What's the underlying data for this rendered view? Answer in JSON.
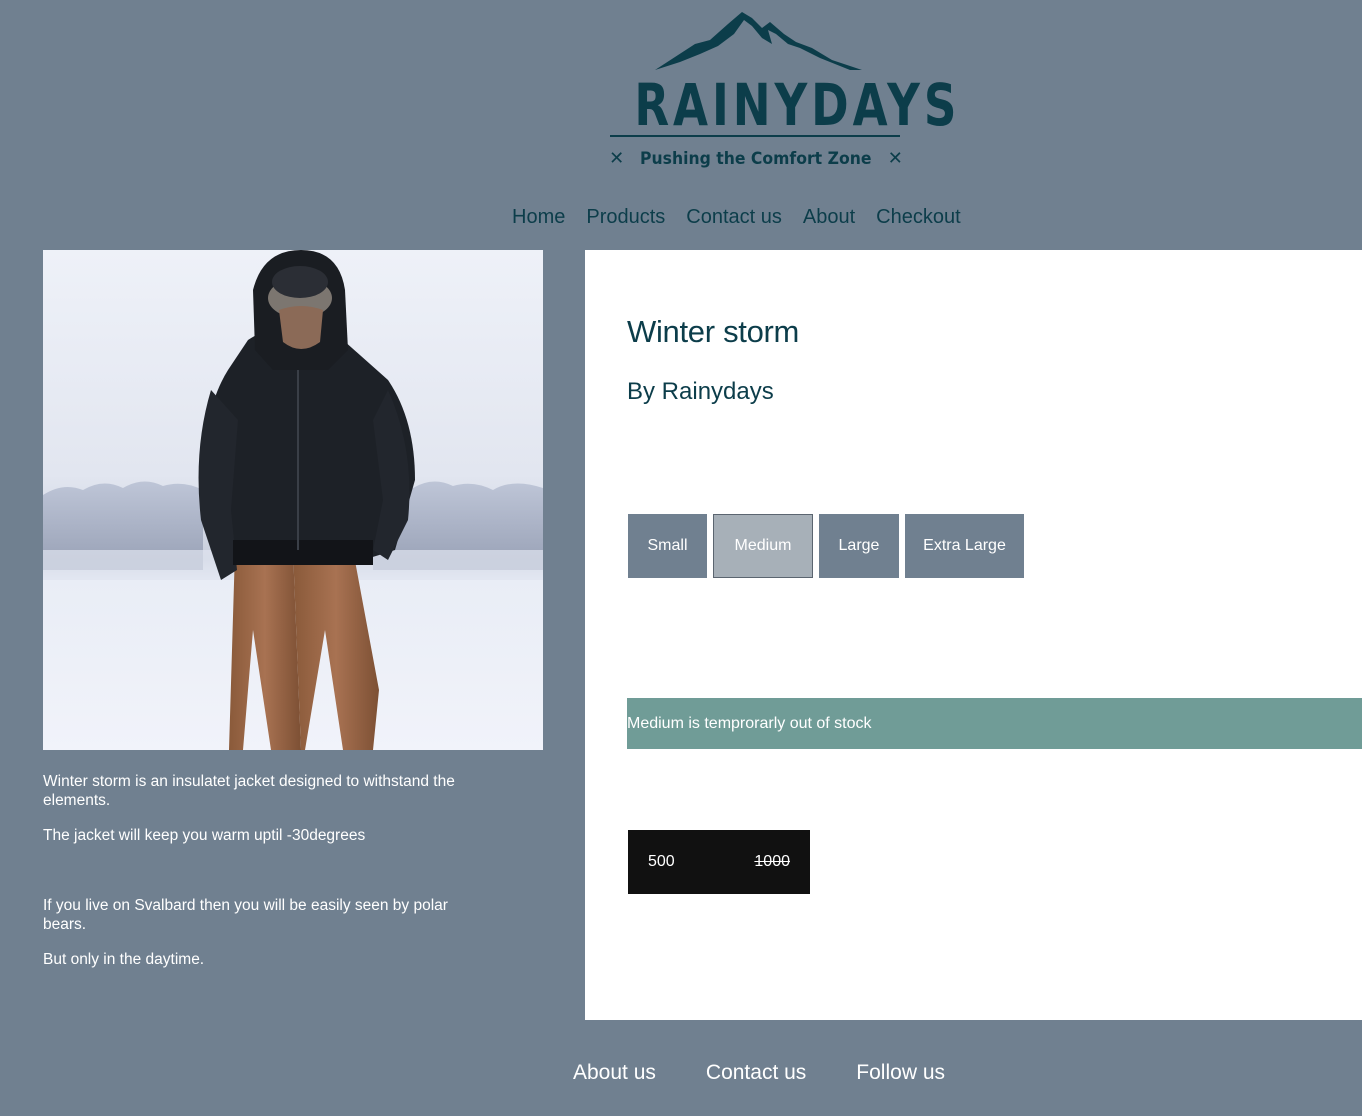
{
  "header": {
    "logo_brand": "RAINYDAYS",
    "logo_tagline": "Pushing the Comfort Zone"
  },
  "nav": {
    "items": [
      "Home",
      "Products",
      "Contact us",
      "About",
      "Checkout"
    ]
  },
  "product": {
    "title": "Winter storm",
    "brand": "By Rainydays",
    "image_alt": "Man in black winter jacket standing in snow",
    "description": [
      "Winter storm is an insulatet jacket designed to withstand the elements.",
      "The jacket will keep you warm uptil -30degrees",
      "If you live on Svalbard then you will be easily seen by polar bears.",
      "But only in the daytime."
    ],
    "sizes": [
      "Small",
      "Medium",
      "Large",
      "Extra Large"
    ],
    "selected_size": "Medium",
    "stock_message": "Medium is temprorarly out of stock",
    "price": "500",
    "old_price": "1000"
  },
  "footer": {
    "items": [
      "About us",
      "Contact us",
      "Follow us"
    ]
  },
  "colors": {
    "background": "#708090",
    "brand_dark": "#0c3d4a",
    "stock_banner": "#709c97",
    "price_box": "#111111",
    "panel": "#ffffff"
  }
}
